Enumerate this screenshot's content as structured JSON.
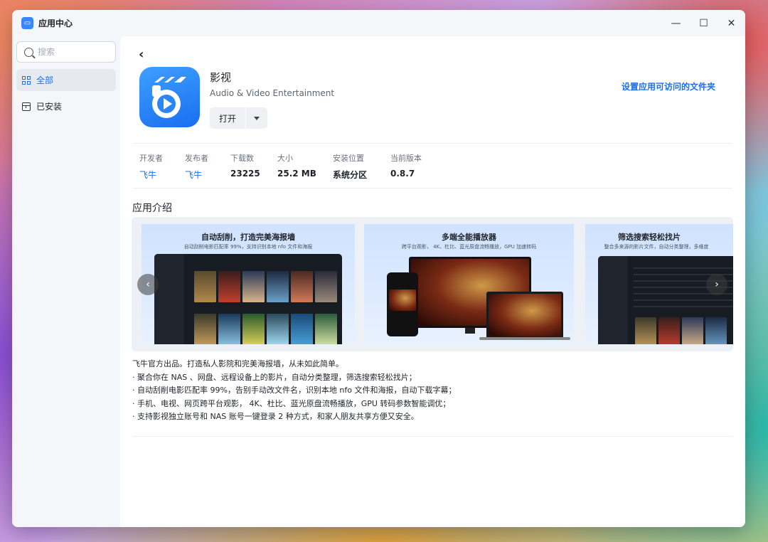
{
  "window": {
    "title": "应用中心",
    "logo_text": "▭"
  },
  "controls": {
    "minimize": "—",
    "maximize": "☐",
    "close": "✕"
  },
  "sidebar": {
    "search_placeholder": "搜索",
    "items": [
      {
        "label": "全部",
        "active": true
      },
      {
        "label": "已安装",
        "active": false
      }
    ]
  },
  "app": {
    "name": "影视",
    "subtitle": "Audio & Video Entertainment",
    "open_label": "打开",
    "folder_link": "设置应用可访问的文件夹"
  },
  "meta": [
    {
      "key": "开发者",
      "value": "飞牛",
      "link": true
    },
    {
      "key": "发布者",
      "value": "飞牛",
      "link": true
    },
    {
      "key": "下载数",
      "value": "23225",
      "link": false
    },
    {
      "key": "大小",
      "value": "25.2 MB",
      "link": false
    },
    {
      "key": "安装位置",
      "value": "系统分区",
      "link": false
    },
    {
      "key": "当前版本",
      "value": "0.8.7",
      "link": false
    }
  ],
  "intro": {
    "title": "应用介绍",
    "screenshots": [
      {
        "heading": "自动刮削，打造完美海报墙",
        "sub": "自动刮削电影匹配率 99%，支持识别本地 nfo 文件和海报"
      },
      {
        "heading": "多端全能播放器",
        "sub": "跨平台观影， 4K、杜比、蓝光原盘流畅播放，GPU 加速转码"
      },
      {
        "heading": "筛选搜索轻松找片",
        "sub": "整合多来源的影片文件，自动分类整理，多维度"
      }
    ],
    "lines": [
      "飞牛官方出品。打造私人影院和完美海报墙，从未如此简单。",
      "· 聚合你在 NAS 、网盘、远程设备上的影片，自动分类整理，筛选搜索轻松找片；",
      "· 自动刮削电影匹配率 99%，告别手动改文件名，识别本地 nfo 文件和海报，自动下载字幕；",
      "· 手机、电视、网页跨平台观影， 4K、杜比、蓝光原盘流畅播放，GPU 转码参数智能调优；",
      "· 支持影视独立账号和 NAS 账号一键登录 2 种方式，和家人朋友共享方便又安全。"
    ]
  },
  "colors": {
    "accent": "#1f6fe6",
    "icon_bg": "#2a86f7"
  }
}
